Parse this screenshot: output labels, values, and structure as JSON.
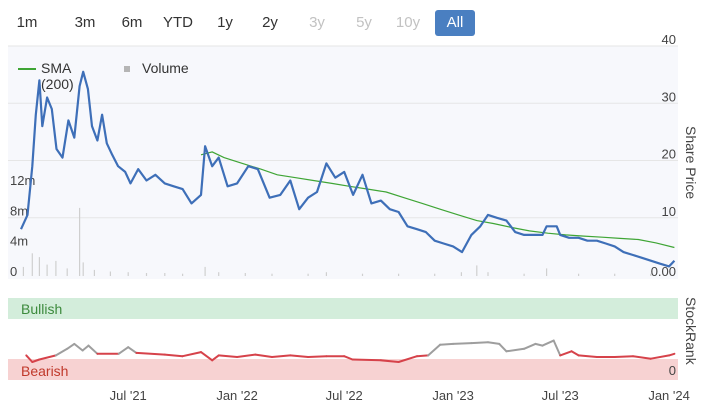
{
  "range_buttons": [
    {
      "label": "1m",
      "state": "normal"
    },
    {
      "label": "3m",
      "state": "normal"
    },
    {
      "label": "6m",
      "state": "normal"
    },
    {
      "label": "YTD",
      "state": "normal"
    },
    {
      "label": "1y",
      "state": "normal"
    },
    {
      "label": "2y",
      "state": "normal"
    },
    {
      "label": "3y",
      "state": "disabled"
    },
    {
      "label": "5y",
      "state": "disabled"
    },
    {
      "label": "10y",
      "state": "disabled"
    },
    {
      "label": "All",
      "state": "active"
    }
  ],
  "legend": {
    "sma_label": "SMA (200)",
    "volume_label": "Volume"
  },
  "colors": {
    "price": "#3e6fb8",
    "sma": "#3fa535",
    "volume": "#cfcfcf",
    "plot_bg": "#f7f8fc",
    "bullish_band": "#d3eddb",
    "bearish_band": "#f7d2d2",
    "rank_low": "#d6424a",
    "rank_high": "#9e9e9e",
    "bullish_text": "#3c8a3c",
    "bearish_text": "#c0392b",
    "active_button": "#4a7fc1"
  },
  "chart_data": [
    {
      "type": "line",
      "y_axis_title": "Share Price",
      "ylim": [
        0,
        40
      ],
      "y_ticks": [
        "0.00",
        "10",
        "20",
        "30",
        "40"
      ],
      "series": [
        {
          "name": "Share Price",
          "points": [
            [
              "2021-01-01",
              8.0
            ],
            [
              "2021-01-12",
              10.5
            ],
            [
              "2021-01-20",
              19.0
            ],
            [
              "2021-01-26",
              28.0
            ],
            [
              "2021-02-01",
              34.0
            ],
            [
              "2021-02-06",
              26.0
            ],
            [
              "2021-02-14",
              31.0
            ],
            [
              "2021-02-22",
              29.0
            ],
            [
              "2021-03-02",
              22.0
            ],
            [
              "2021-03-12",
              20.5
            ],
            [
              "2021-03-22",
              27.0
            ],
            [
              "2021-04-01",
              24.0
            ],
            [
              "2021-04-10",
              33.0
            ],
            [
              "2021-04-16",
              35.5
            ],
            [
              "2021-04-24",
              32.5
            ],
            [
              "2021-05-01",
              26.0
            ],
            [
              "2021-05-10",
              23.5
            ],
            [
              "2021-05-18",
              28.0
            ],
            [
              "2021-05-26",
              23.0
            ],
            [
              "2021-06-04",
              21.0
            ],
            [
              "2021-06-14",
              19.0
            ],
            [
              "2021-06-26",
              18.0
            ],
            [
              "2021-07-05",
              16.0
            ],
            [
              "2021-07-18",
              18.5
            ],
            [
              "2021-08-01",
              16.5
            ],
            [
              "2021-08-16",
              17.5
            ],
            [
              "2021-09-01",
              16.0
            ],
            [
              "2021-09-16",
              15.5
            ],
            [
              "2021-10-01",
              15.0
            ],
            [
              "2021-10-16",
              12.5
            ],
            [
              "2021-11-01",
              14.0
            ],
            [
              "2021-11-08",
              22.5
            ],
            [
              "2021-11-20",
              19.0
            ],
            [
              "2021-12-01",
              20.5
            ],
            [
              "2021-12-16",
              15.5
            ],
            [
              "2022-01-01",
              16.0
            ],
            [
              "2022-01-20",
              19.0
            ],
            [
              "2022-02-05",
              18.5
            ],
            [
              "2022-02-25",
              13.5
            ],
            [
              "2022-03-15",
              14.0
            ],
            [
              "2022-04-01",
              16.5
            ],
            [
              "2022-04-16",
              11.5
            ],
            [
              "2022-05-01",
              13.5
            ],
            [
              "2022-05-16",
              14.5
            ],
            [
              "2022-06-01",
              19.5
            ],
            [
              "2022-06-16",
              17.0
            ],
            [
              "2022-07-01",
              18.0
            ],
            [
              "2022-07-16",
              14.0
            ],
            [
              "2022-08-01",
              17.5
            ],
            [
              "2022-08-16",
              12.5
            ],
            [
              "2022-09-01",
              13.0
            ],
            [
              "2022-09-16",
              11.5
            ],
            [
              "2022-10-01",
              11.0
            ],
            [
              "2022-10-16",
              8.5
            ],
            [
              "2022-11-01",
              8.0
            ],
            [
              "2022-11-16",
              7.5
            ],
            [
              "2022-12-01",
              6.0
            ],
            [
              "2022-12-16",
              5.5
            ],
            [
              "2023-01-01",
              5.0
            ],
            [
              "2023-01-16",
              4.0
            ],
            [
              "2023-02-01",
              7.0
            ],
            [
              "2023-02-16",
              8.5
            ],
            [
              "2023-03-01",
              10.5
            ],
            [
              "2023-03-16",
              10.0
            ],
            [
              "2023-04-01",
              9.5
            ],
            [
              "2023-04-16",
              7.5
            ],
            [
              "2023-05-01",
              7.0
            ],
            [
              "2023-05-16",
              7.0
            ],
            [
              "2023-06-01",
              7.0
            ],
            [
              "2023-06-08",
              8.5
            ],
            [
              "2023-06-25",
              8.5
            ],
            [
              "2023-07-01",
              7.0
            ],
            [
              "2023-07-16",
              6.5
            ],
            [
              "2023-08-01",
              6.5
            ],
            [
              "2023-08-16",
              6.0
            ],
            [
              "2023-09-01",
              6.0
            ],
            [
              "2023-09-16",
              5.5
            ],
            [
              "2023-10-01",
              5.0
            ],
            [
              "2023-10-16",
              4.0
            ],
            [
              "2023-11-01",
              3.5
            ],
            [
              "2023-11-16",
              3.0
            ],
            [
              "2023-12-01",
              2.5
            ],
            [
              "2023-12-16",
              2.0
            ],
            [
              "2024-01-01",
              1.5
            ],
            [
              "2024-01-10",
              2.5
            ]
          ]
        },
        {
          "name": "SMA (200)",
          "points": [
            [
              "2021-11-01",
              21.0
            ],
            [
              "2021-11-20",
              21.5
            ],
            [
              "2021-12-10",
              20.5
            ],
            [
              "2022-01-10",
              19.5
            ],
            [
              "2022-02-10",
              18.5
            ],
            [
              "2022-03-10",
              17.5
            ],
            [
              "2022-04-10",
              17.0
            ],
            [
              "2022-05-10",
              16.5
            ],
            [
              "2022-06-10",
              16.0
            ],
            [
              "2022-07-10",
              15.5
            ],
            [
              "2022-08-10",
              15.0
            ],
            [
              "2022-09-10",
              14.5
            ],
            [
              "2022-10-10",
              13.5
            ],
            [
              "2022-11-10",
              12.5
            ],
            [
              "2022-12-10",
              11.5
            ],
            [
              "2023-01-10",
              10.5
            ],
            [
              "2023-02-10",
              9.5
            ],
            [
              "2023-03-10",
              9.0
            ],
            [
              "2023-04-10",
              8.3
            ],
            [
              "2023-05-10",
              7.7
            ],
            [
              "2023-06-10",
              7.3
            ],
            [
              "2023-07-10",
              7.0
            ],
            [
              "2023-08-10",
              6.8
            ],
            [
              "2023-09-10",
              6.6
            ],
            [
              "2023-10-10",
              6.4
            ],
            [
              "2023-11-10",
              6.2
            ],
            [
              "2023-12-10",
              5.6
            ],
            [
              "2024-01-10",
              4.8
            ]
          ]
        }
      ]
    },
    {
      "type": "bar",
      "name": "Volume",
      "y_ticks": [
        "0",
        "4m",
        "8m",
        "12m"
      ],
      "ylim": [
        0,
        14
      ],
      "unit": "m",
      "points": [
        [
          "2021-01-05",
          1.2
        ],
        [
          "2021-01-20",
          3.0
        ],
        [
          "2021-02-01",
          2.5
        ],
        [
          "2021-02-14",
          1.5
        ],
        [
          "2021-03-01",
          2.0
        ],
        [
          "2021-03-20",
          1.0
        ],
        [
          "2021-04-10",
          9.0
        ],
        [
          "2021-04-16",
          1.8
        ],
        [
          "2021-05-05",
          0.8
        ],
        [
          "2021-06-01",
          0.6
        ],
        [
          "2021-07-01",
          0.5
        ],
        [
          "2021-08-01",
          0.4
        ],
        [
          "2021-09-01",
          0.4
        ],
        [
          "2021-10-01",
          0.3
        ],
        [
          "2021-11-08",
          1.2
        ],
        [
          "2021-12-01",
          0.5
        ],
        [
          "2022-01-15",
          0.4
        ],
        [
          "2022-03-01",
          0.3
        ],
        [
          "2022-05-01",
          0.3
        ],
        [
          "2022-06-01",
          0.5
        ],
        [
          "2022-08-01",
          0.3
        ],
        [
          "2022-10-01",
          0.3
        ],
        [
          "2022-12-01",
          0.3
        ],
        [
          "2023-01-15",
          0.5
        ],
        [
          "2023-02-10",
          1.4
        ],
        [
          "2023-03-01",
          0.5
        ],
        [
          "2023-05-01",
          0.3
        ],
        [
          "2023-06-08",
          1.0
        ],
        [
          "2023-08-01",
          0.3
        ],
        [
          "2023-10-01",
          0.3
        ],
        [
          "2023-12-01",
          0.3
        ]
      ]
    },
    {
      "type": "line",
      "name": "StockRank",
      "y_axis_title": "StockRank",
      "y_ticks": [
        "0"
      ],
      "ylim": [
        0,
        100
      ],
      "band_labels": {
        "top": "Bullish",
        "bottom": "Bearish"
      },
      "threshold": 30,
      "points": [
        [
          "2021-01-10",
          30
        ],
        [
          "2021-01-20",
          22
        ],
        [
          "2021-02-01",
          25
        ],
        [
          "2021-03-01",
          30
        ],
        [
          "2021-03-20",
          38
        ],
        [
          "2021-04-01",
          44
        ],
        [
          "2021-04-15",
          36
        ],
        [
          "2021-04-25",
          42
        ],
        [
          "2021-05-10",
          32
        ],
        [
          "2021-06-15",
          32
        ],
        [
          "2021-07-01",
          40
        ],
        [
          "2021-07-15",
          33
        ],
        [
          "2021-09-01",
          31
        ],
        [
          "2021-10-01",
          29
        ],
        [
          "2021-11-01",
          34
        ],
        [
          "2021-11-20",
          24
        ],
        [
          "2021-12-01",
          30
        ],
        [
          "2022-01-01",
          28
        ],
        [
          "2022-02-01",
          31
        ],
        [
          "2022-03-01",
          28
        ],
        [
          "2022-04-01",
          30
        ],
        [
          "2022-05-01",
          28
        ],
        [
          "2022-06-01",
          29
        ],
        [
          "2022-07-01",
          29
        ],
        [
          "2022-07-15",
          25
        ],
        [
          "2022-09-01",
          24
        ],
        [
          "2022-10-01",
          22
        ],
        [
          "2022-11-01",
          29
        ],
        [
          "2022-11-20",
          30
        ],
        [
          "2022-12-10",
          43
        ],
        [
          "2023-01-01",
          44
        ],
        [
          "2023-02-01",
          45
        ],
        [
          "2023-03-01",
          46
        ],
        [
          "2023-03-20",
          44
        ],
        [
          "2023-04-01",
          35
        ],
        [
          "2023-05-01",
          38
        ],
        [
          "2023-05-20",
          44
        ],
        [
          "2023-06-01",
          42
        ],
        [
          "2023-06-20",
          48
        ],
        [
          "2023-07-01",
          30
        ],
        [
          "2023-07-20",
          35
        ],
        [
          "2023-08-01",
          30
        ],
        [
          "2023-09-01",
          28
        ],
        [
          "2023-10-01",
          28
        ],
        [
          "2023-11-01",
          29
        ],
        [
          "2023-12-01",
          26
        ],
        [
          "2024-01-01",
          30
        ],
        [
          "2024-01-10",
          32
        ]
      ]
    }
  ],
  "x_axis": {
    "start": "2020-12-10",
    "end": "2024-01-16",
    "labels": [
      {
        "date": "2021-07-01",
        "text": "Jul '21"
      },
      {
        "date": "2022-01-01",
        "text": "Jan '22"
      },
      {
        "date": "2022-07-01",
        "text": "Jul '22"
      },
      {
        "date": "2023-01-01",
        "text": "Jan '23"
      },
      {
        "date": "2023-07-01",
        "text": "Jul '23"
      },
      {
        "date": "2024-01-01",
        "text": "Jan '24"
      }
    ]
  }
}
